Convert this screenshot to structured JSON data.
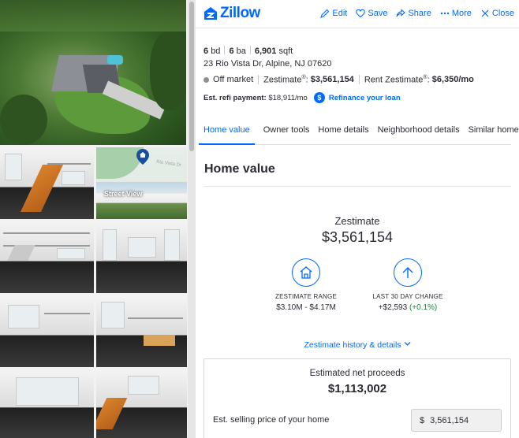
{
  "brand": {
    "name": "Zillow",
    "color": "#006aff"
  },
  "toolbar": {
    "edit": "Edit",
    "save": "Save",
    "share": "Share",
    "more": "More",
    "close": "Close"
  },
  "gallery": {
    "street_view_label": "Street View",
    "map_road_label": "Rio Vista Dr"
  },
  "facts": {
    "beds_num": "6",
    "beds_unit": "bd",
    "baths_num": "6",
    "baths_unit": "ba",
    "sqft_num": "6,901",
    "sqft_unit": "sqft"
  },
  "address": "23 Rio Vista Dr, Alpine, NJ 07620",
  "status": {
    "market": "Off market",
    "zestimate_label": "Zestimate",
    "zestimate_sup": "®",
    "zestimate_value": "$3,561,154",
    "rent_label": "Rent Zestimate",
    "rent_sup": "®",
    "rent_value": "$6,350/mo"
  },
  "refi": {
    "label": "Est. refi payment:",
    "value": "$18,911/mo",
    "icon_text": "$",
    "link": "Refinance your loan"
  },
  "tabs": [
    "Home value",
    "Owner tools",
    "Home details",
    "Neighborhood details",
    "Similar homes"
  ],
  "home_value": {
    "title": "Home value",
    "zestimate_label": "Zestimate",
    "zestimate_value": "$3,561,154",
    "range_label": "ZESTIMATE RANGE",
    "range_value": "$3.10M - $4.17M",
    "change_label": "LAST 30 DAY CHANGE",
    "change_value": "+$2,593",
    "change_pct": "(+0.1%)",
    "history_link": "Zestimate history & details"
  },
  "proceeds": {
    "label": "Estimated net proceeds",
    "value": "$1,113,002",
    "selling_label": "Est. selling price of your home",
    "currency": "$",
    "selling_value": "3,561,154"
  }
}
